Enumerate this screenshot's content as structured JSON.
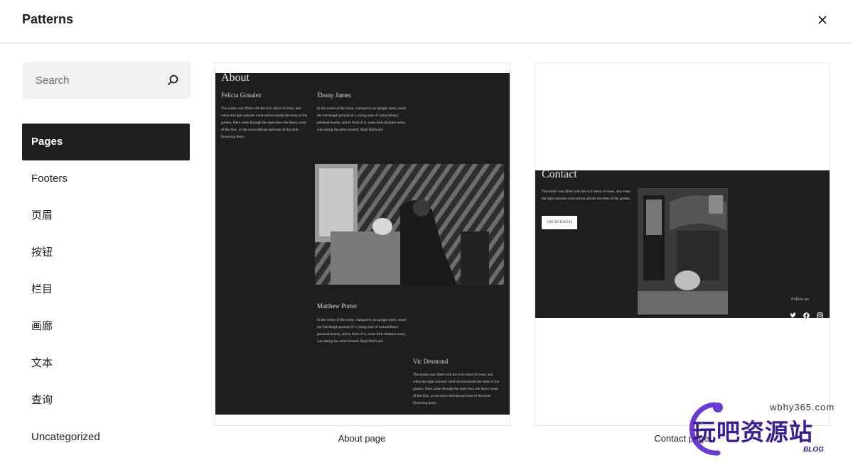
{
  "modal": {
    "title": "Patterns",
    "close_icon": "close-icon"
  },
  "search": {
    "placeholder": "Search",
    "icon": "search-icon"
  },
  "sidebar": {
    "items": [
      {
        "label": "Pages",
        "active": true
      },
      {
        "label": "Footers"
      },
      {
        "label": "页眉"
      },
      {
        "label": "按钮"
      },
      {
        "label": "栏目"
      },
      {
        "label": "画廊"
      },
      {
        "label": "文本"
      },
      {
        "label": "查询"
      },
      {
        "label": "Uncategorized"
      }
    ]
  },
  "patterns": [
    {
      "caption": "About page",
      "preview": {
        "heading": "About",
        "people": [
          {
            "name": "Felicia Gonalez",
            "text": "The studio was filled with the rich odour of roses, and when the light summer wind stirred amidst the trees of the garden, there came through the open door the heavy scent of the lilac, or the more delicate perfume of the pink-flowering thorn."
          },
          {
            "name": "Ebony James",
            "text": "In the centre of the room, clamped to an upright easel, stood the full-length portrait of a young man of extraordinary personal beauty, and in front of it, some little distance away, was sitting the artist himself, Basil Hallward."
          },
          {
            "name": "Matthew Porter",
            "text": "In the centre of the room, clamped to an upright easel, stood the full-length portrait of a young man of extraordinary personal beauty, and in front of it, some little distance away, was sitting the artist himself, Basil Hallward."
          },
          {
            "name": "Vic Desmond",
            "text": "The studio was filled with the rich odour of roses, and when the light summer wind stirred amidst the trees of the garden, there came through the open door the heavy scent of the lilac, or the more delicate perfume of the pink-flowering thorn."
          }
        ]
      }
    },
    {
      "caption": "Contact page",
      "preview": {
        "heading": "Contact",
        "text": "The studio was filled with the rich odour of roses, and when the light summer wind stirred amidst the trees of the garden.",
        "button": "GET IN TOUCH",
        "follow": "Follow us:",
        "social_icons": [
          "twitter-icon",
          "facebook-icon",
          "instagram-icon"
        ]
      }
    }
  ],
  "watermark": {
    "domain": "wbhy365.com",
    "name": "玩吧资源站",
    "sub": "BLOG"
  },
  "colors": {
    "dark": "#1e1e1e",
    "active_bg": "#1e1e1e",
    "watermark_purple": "#6a3bd1"
  }
}
